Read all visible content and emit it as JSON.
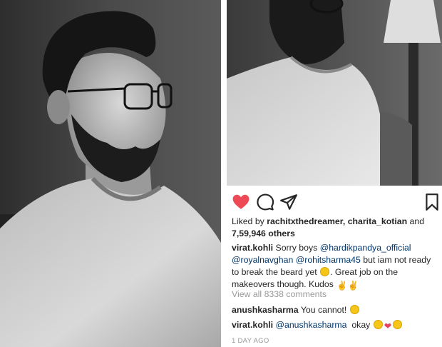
{
  "post": {
    "likes_prefix": "Liked by",
    "liked_by_1": "rachitxthedreamer",
    "liked_by_sep": ",",
    "liked_by_2": "charita_kotian",
    "likes_and": "and",
    "likes_count": "7,59,946 others",
    "caption": {
      "user": "virat.kohli",
      "part1": "Sorry boys",
      "mention1": "@hardikpandya_official",
      "mention2": "@royalnavghan",
      "mention3": "@rohitsharma45",
      "part2": "but iam not ready to break the beard yet",
      "part3": ". Great job on the makeovers though. Kudos"
    },
    "view_comments": "View all 8338 comments",
    "comments": [
      {
        "user": "anushkasharma",
        "text": "You cannot!"
      },
      {
        "user": "virat.kohli",
        "mention": "@anushkasharma",
        "text": "okay"
      }
    ],
    "timestamp": "1 DAY AGO"
  },
  "icons": {
    "like": "heart-filled-icon",
    "comment": "comment-bubble-icon",
    "share": "paper-plane-icon",
    "save": "bookmark-icon"
  },
  "colors": {
    "like": "#ed4956",
    "mention": "#003569",
    "muted": "#999999",
    "text": "#262626"
  }
}
